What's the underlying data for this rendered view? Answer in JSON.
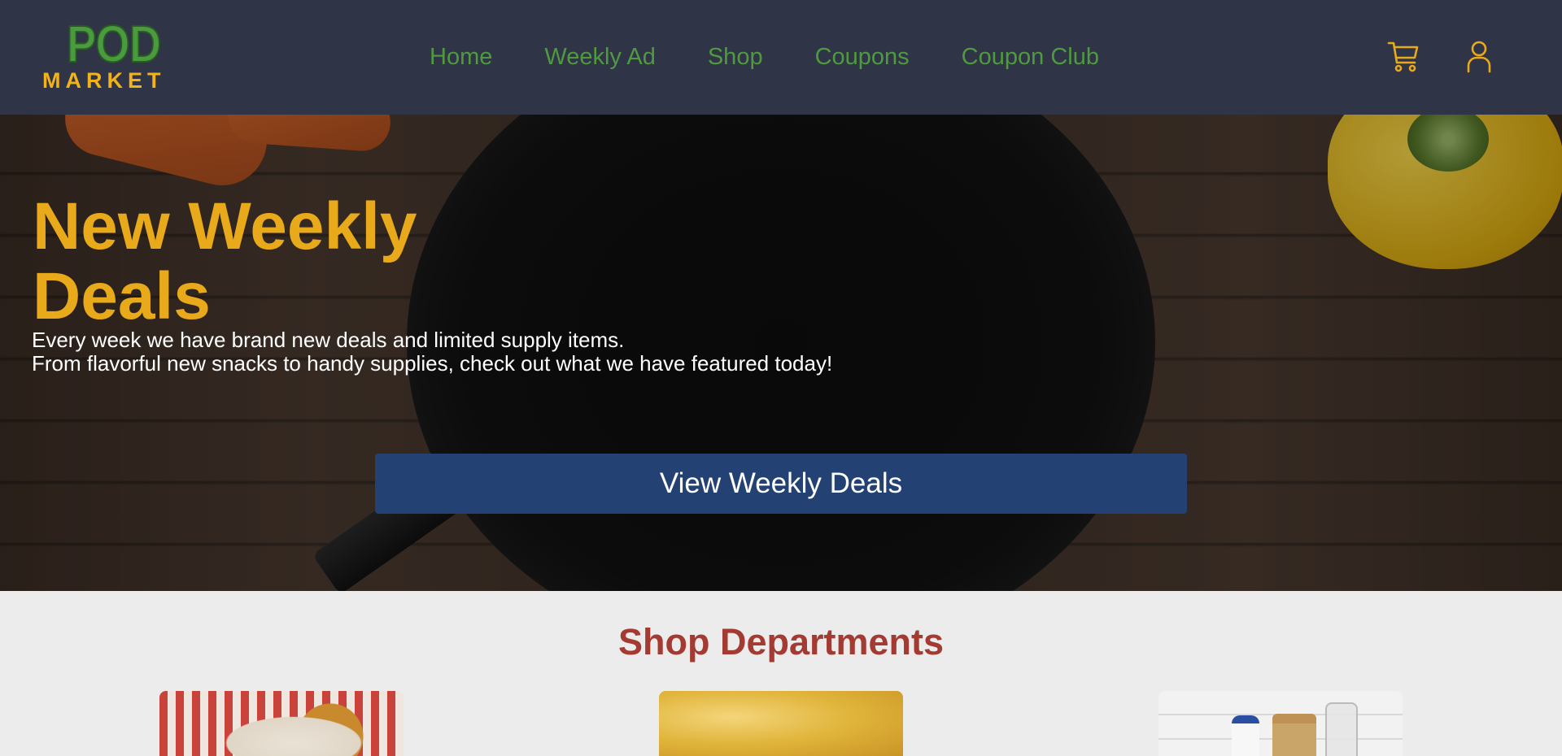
{
  "brand": {
    "logo_top": "POD",
    "logo_bottom": "MARKET"
  },
  "nav": {
    "items": [
      {
        "label": "Home"
      },
      {
        "label": "Weekly Ad"
      },
      {
        "label": "Shop"
      },
      {
        "label": "Coupons"
      },
      {
        "label": "Coupon Club"
      }
    ],
    "icons": [
      "cart-icon",
      "user-icon"
    ]
  },
  "hero": {
    "title": "New Weekly Deals",
    "subtitle_line1": "Every week we have brand new deals and limited supply items.",
    "subtitle_line2": "From flavorful new snacks to handy supplies, check out what we have featured today!",
    "cta_label": "View Weekly Deals"
  },
  "departments": {
    "title": "Shop Departments"
  },
  "colors": {
    "header_bg": "#2f3447",
    "nav_text": "#4f9a3f",
    "accent_yellow": "#e8a91a",
    "cta_bg": "#234273",
    "section_title": "#a43b32"
  }
}
